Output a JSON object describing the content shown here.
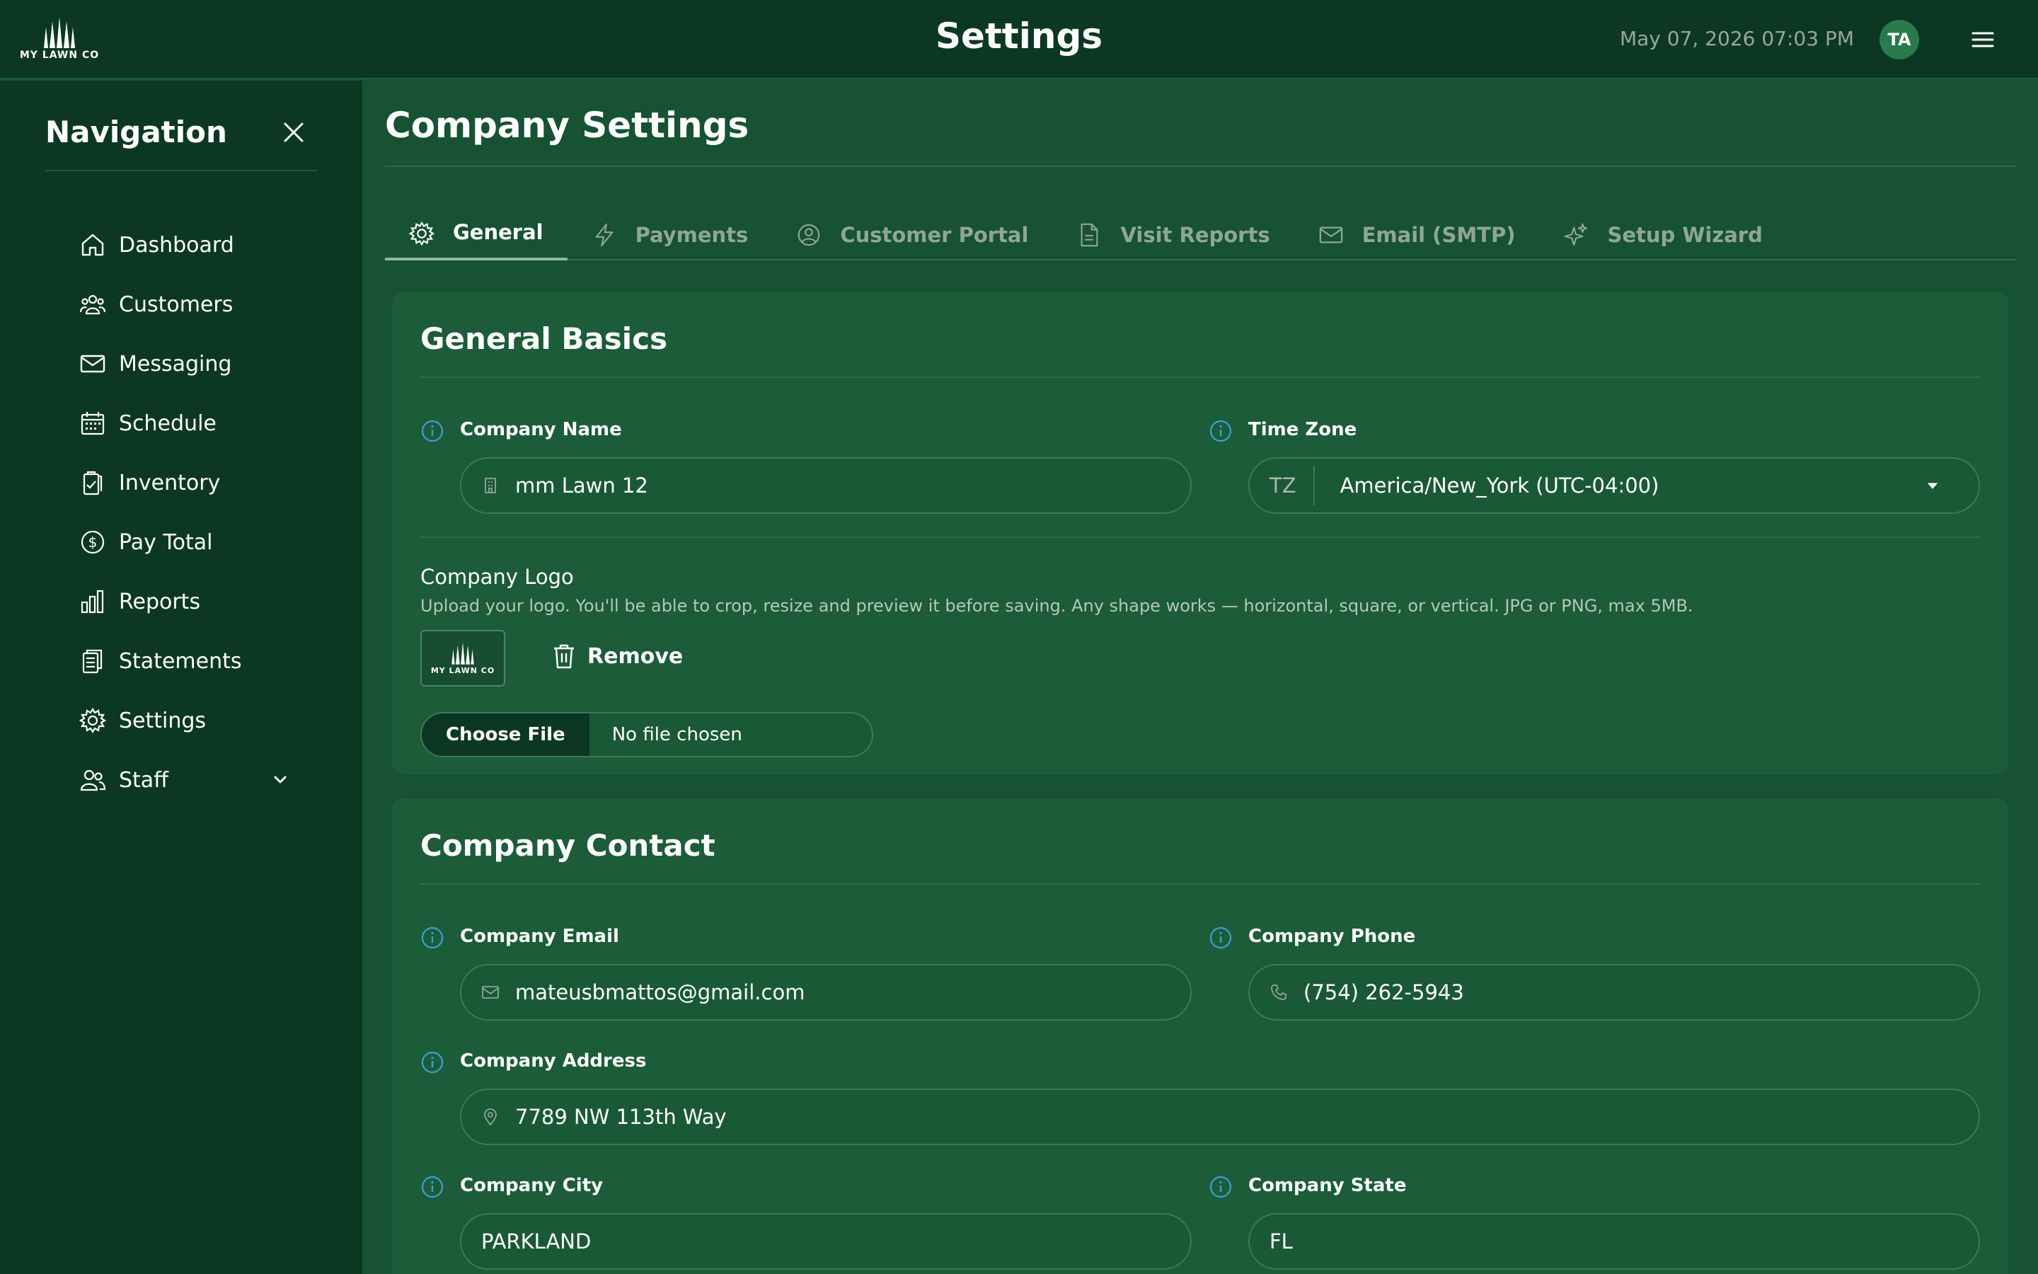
{
  "header": {
    "logo_text": "MY LAWN CO",
    "title": "Settings",
    "datetime": "May 07, 2026 07:03 PM",
    "avatar_initials": "TA"
  },
  "sidebar": {
    "title": "Navigation",
    "items": [
      {
        "label": "Dashboard",
        "icon": "home-icon"
      },
      {
        "label": "Customers",
        "icon": "users-icon"
      },
      {
        "label": "Messaging",
        "icon": "mail-icon"
      },
      {
        "label": "Schedule",
        "icon": "calendar-icon"
      },
      {
        "label": "Inventory",
        "icon": "clipboard-check-icon"
      },
      {
        "label": "Pay Total",
        "icon": "dollar-circle-icon"
      },
      {
        "label": "Reports",
        "icon": "bar-chart-icon"
      },
      {
        "label": "Statements",
        "icon": "documents-icon"
      },
      {
        "label": "Settings",
        "icon": "gear-icon"
      },
      {
        "label": "Staff",
        "icon": "staff-icon"
      }
    ]
  },
  "main": {
    "title": "Company Settings",
    "tabs": [
      {
        "label": "General",
        "icon": "gear-icon",
        "active": true
      },
      {
        "label": "Payments",
        "icon": "lightning-icon"
      },
      {
        "label": "Customer Portal",
        "icon": "user-circle-icon"
      },
      {
        "label": "Visit Reports",
        "icon": "document-icon"
      },
      {
        "label": "Email (SMTP)",
        "icon": "mail-icon"
      },
      {
        "label": "Setup Wizard",
        "icon": "sparkles-icon"
      }
    ]
  },
  "general_basics": {
    "title": "General Basics",
    "company_name_label": "Company Name",
    "company_name_value": "mm Lawn 12",
    "time_zone_label": "Time Zone",
    "time_zone_prefix": "TZ",
    "time_zone_value": "America/New_York (UTC-04:00)",
    "logo_label": "Company Logo",
    "logo_help": "Upload your logo. You'll be able to crop, resize and preview it before saving. Any shape works — horizontal, square, or vertical. JPG or PNG, max 5MB.",
    "remove_label": "Remove",
    "choose_file_label": "Choose File",
    "no_file_label": "No file chosen"
  },
  "company_contact": {
    "title": "Company Contact",
    "email_label": "Company Email",
    "email_value": "mateusbmattos@gmail.com",
    "phone_label": "Company Phone",
    "phone_value": "(754) 262-5943",
    "address_label": "Company Address",
    "address_value": "7789 NW 113th Way",
    "city_label": "Company City",
    "city_value": "PARKLAND",
    "state_label": "Company State",
    "state_value": "FL"
  },
  "colors": {
    "background": "#175232",
    "sidebar": "#0c3823",
    "card": "#1c5c38",
    "info_accent": "#3aa0d8"
  }
}
